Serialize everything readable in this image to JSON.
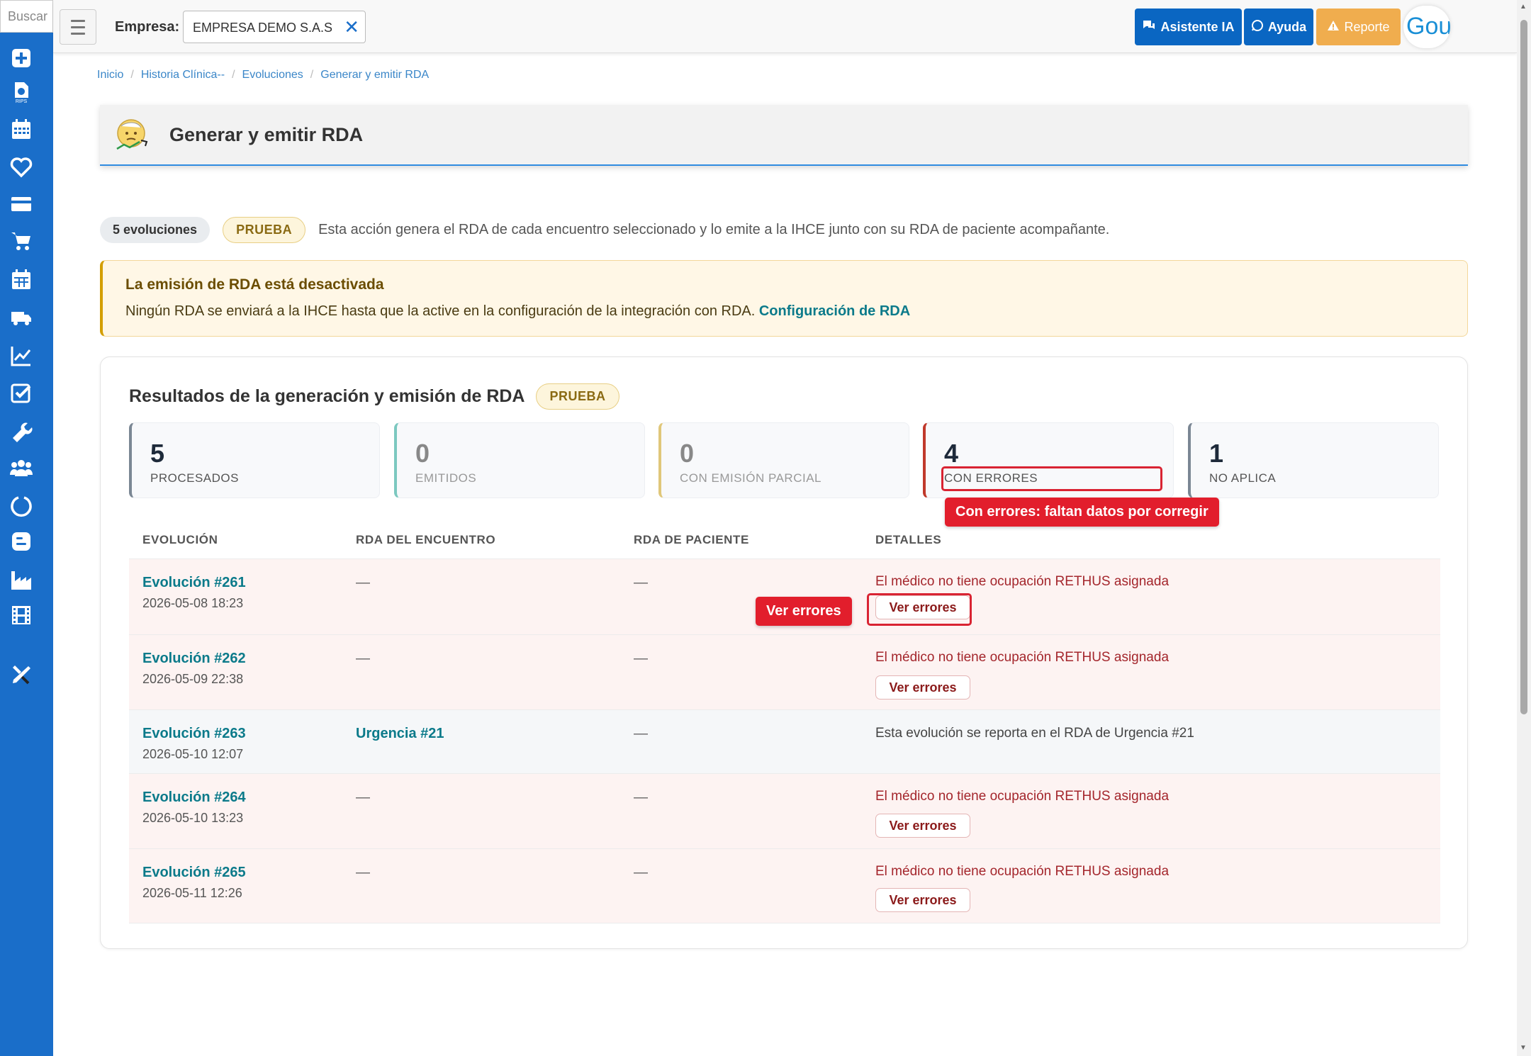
{
  "search": {
    "placeholder": "Buscar"
  },
  "topbar": {
    "empresa_label": "Empresa:",
    "empresa_value": "EMPRESA DEMO S.A.S",
    "asistente_label": "Asistente IA",
    "ayuda_label": "Ayuda",
    "reporte_label": "Reporte",
    "logo_text": "Gou"
  },
  "sidebar": {
    "icons": [
      "plus-square-icon",
      "rips-file-icon",
      "calendar-icon",
      "heart-icon",
      "credit-card-icon",
      "cart-icon",
      "calendar-grid-icon",
      "truck-icon",
      "chart-line-icon",
      "check-square-icon",
      "wrench-icon",
      "users-icon",
      "circle-notch-icon",
      "blogger-icon",
      "industry-icon",
      "film-icon",
      "tools-icon"
    ]
  },
  "breadcrumb": [
    "Inicio",
    "Historia Clínica--",
    "Evoluciones",
    "Generar y emitir RDA"
  ],
  "page": {
    "title": "Generar y emitir RDA"
  },
  "summary": {
    "count": "5 evoluciones",
    "badge": "PRUEBA",
    "text": "Esta acción genera el RDA de cada encuentro seleccionado y lo emite a la IHCE junto con su RDA de paciente acompañante."
  },
  "alert": {
    "title": "La emisión de RDA está desactivada",
    "text": "Ningún RDA se enviará a la IHCE hasta que la active en la configuración de la integración con RDA.",
    "link": "Configuración de RDA"
  },
  "results": {
    "title": "Resultados de la generación y emisión de RDA",
    "badge": "PRUEBA",
    "stats": [
      {
        "value": "5",
        "label": "PROCESADOS",
        "color": "#7b8794"
      },
      {
        "value": "0",
        "label": "EMITIDOS",
        "color": "#7cc8c0"
      },
      {
        "value": "0",
        "label": "CON EMISIÓN PARCIAL",
        "color": "#e0c77a"
      },
      {
        "value": "4",
        "label": "CON ERRORES",
        "color": "#c0392b"
      },
      {
        "value": "1",
        "label": "NO APLICA",
        "color": "#7b8794"
      }
    ],
    "errors_tooltip": "Con errores: faltan datos por corregir",
    "ver_errores_tooltip": "Ver errores",
    "columns": [
      "EVOLUCIÓN",
      "RDA DEL ENCUENTRO",
      "RDA DE PACIENTE",
      "DETALLES"
    ],
    "rows": [
      {
        "evolucion": "Evolución #261",
        "fecha": "2026-05-08 18:23",
        "rda_encuentro": "—",
        "rda_paciente": "—",
        "detalle": "El médico no tiene ocupación RETHUS asignada",
        "button": "Ver errores"
      },
      {
        "evolucion": "Evolución #262",
        "fecha": "2026-05-09 22:38",
        "rda_encuentro": "—",
        "rda_paciente": "—",
        "detalle": "El médico no tiene ocupación RETHUS asignada",
        "button": "Ver errores"
      },
      {
        "evolucion": "Evolución #263",
        "fecha": "2026-05-10 12:07",
        "rda_encuentro": "Urgencia #21",
        "rda_paciente": "—",
        "detalle": "Esta evolución se reporta en el RDA de Urgencia #21"
      },
      {
        "evolucion": "Evolución #264",
        "fecha": "2026-05-10 13:23",
        "rda_encuentro": "—",
        "rda_paciente": "—",
        "detalle": "El médico no tiene ocupación RETHUS asignada",
        "button": "Ver errores"
      },
      {
        "evolucion": "Evolución #265",
        "fecha": "2026-05-11 12:26",
        "rda_encuentro": "—",
        "rda_paciente": "—",
        "detalle": "El médico no tiene ocupación RETHUS asignada",
        "button": "Ver errores"
      }
    ]
  }
}
